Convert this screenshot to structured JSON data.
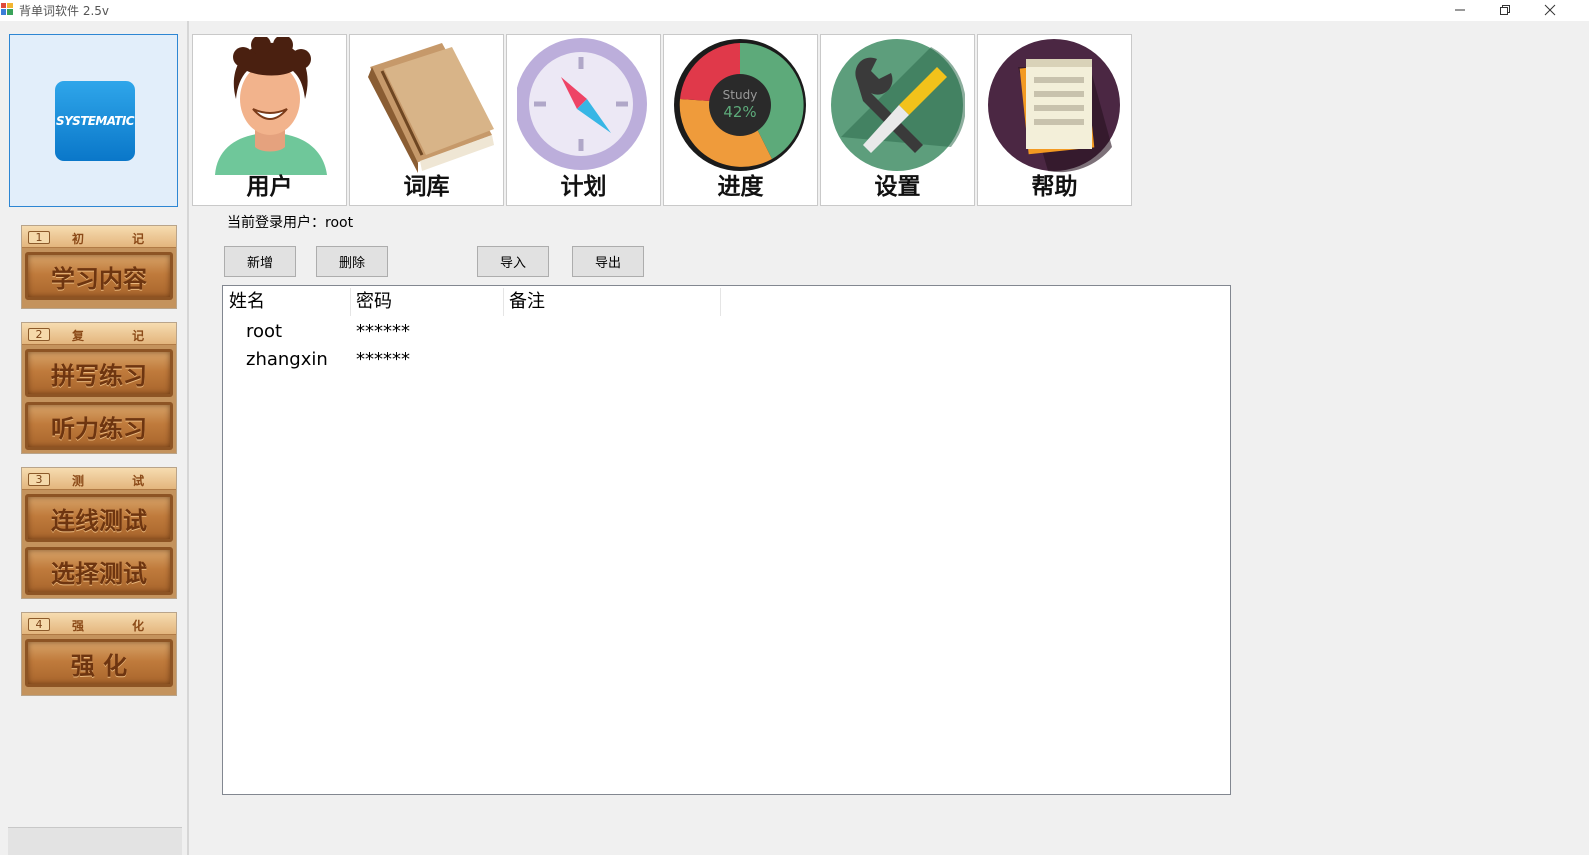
{
  "window": {
    "title": "背单词软件 2.5v",
    "controls": [
      "minimize",
      "restore",
      "close"
    ]
  },
  "sidebar": {
    "logo_text": "SYSTEMATIC",
    "groups": [
      {
        "num": "1",
        "title": "初 记",
        "buttons": [
          "学习内容"
        ]
      },
      {
        "num": "2",
        "title": "复 记",
        "buttons": [
          "拼写练习",
          "听力练习"
        ]
      },
      {
        "num": "3",
        "title": "测 试",
        "buttons": [
          "连线测试",
          "选择测试"
        ]
      },
      {
        "num": "4",
        "title": "强 化",
        "buttons": [
          "强 化"
        ]
      }
    ]
  },
  "toolbar": {
    "tiles": [
      {
        "label": "用户",
        "icon": "user-avatar-icon"
      },
      {
        "label": "词库",
        "icon": "book-icon"
      },
      {
        "label": "计划",
        "icon": "compass-icon"
      },
      {
        "label": "进度",
        "icon": "progress-donut-icon"
      },
      {
        "label": "设置",
        "icon": "wrench-screwdriver-icon"
      },
      {
        "label": "帮助",
        "icon": "notepad-icon"
      }
    ],
    "progress_text": "Study",
    "progress_value": "42%"
  },
  "main": {
    "current_user_label": "当前登录用户：",
    "current_user": "root",
    "buttons": {
      "add": "新增",
      "delete": "删除",
      "import": "导入",
      "export": "导出"
    },
    "table": {
      "columns": [
        "姓名",
        "密码",
        "备注"
      ],
      "rows": [
        {
          "name": "root",
          "password": "******",
          "note": ""
        },
        {
          "name": "zhangxin",
          "password": "******",
          "note": ""
        }
      ]
    }
  },
  "colors": {
    "logo_blue": "#0a77c9",
    "selection_border": "#2d86d3",
    "wood": "#c07b3c"
  }
}
